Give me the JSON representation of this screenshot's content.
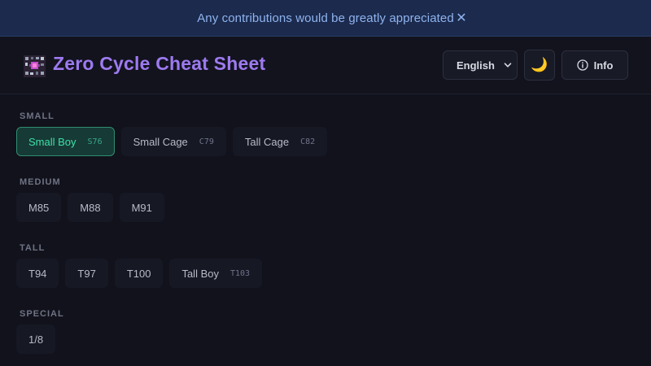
{
  "banner": {
    "text": "Any contributions would be greatly appreciated",
    "close_glyph": "✕"
  },
  "header": {
    "title": "Zero Cycle Cheat Sheet",
    "logo_icon": "cube-logo-icon",
    "language": "English",
    "theme_glyph": "🌙",
    "info_label": "Info"
  },
  "sections": {
    "small": {
      "label": "SMALL",
      "items": [
        {
          "label": "Small Boy",
          "code": "S76",
          "active": true
        },
        {
          "label": "Small Cage",
          "code": "C79"
        },
        {
          "label": "Tall Cage",
          "code": "C82"
        }
      ]
    },
    "medium": {
      "label": "MEDIUM",
      "items": [
        {
          "label": "M85"
        },
        {
          "label": "M88"
        },
        {
          "label": "M91"
        }
      ]
    },
    "tall": {
      "label": "TALL",
      "items": [
        {
          "label": "T94"
        },
        {
          "label": "T97"
        },
        {
          "label": "T100"
        },
        {
          "label": "Tall Boy",
          "code": "T103"
        }
      ]
    },
    "special": {
      "label": "SPECIAL",
      "items": [
        {
          "label": "1/8"
        }
      ]
    }
  },
  "colors": {
    "accent_purple": "#9d7af0",
    "active_green": "#3ee0a8",
    "banner_bg": "#1b2a4d",
    "page_bg": "#11121b"
  }
}
